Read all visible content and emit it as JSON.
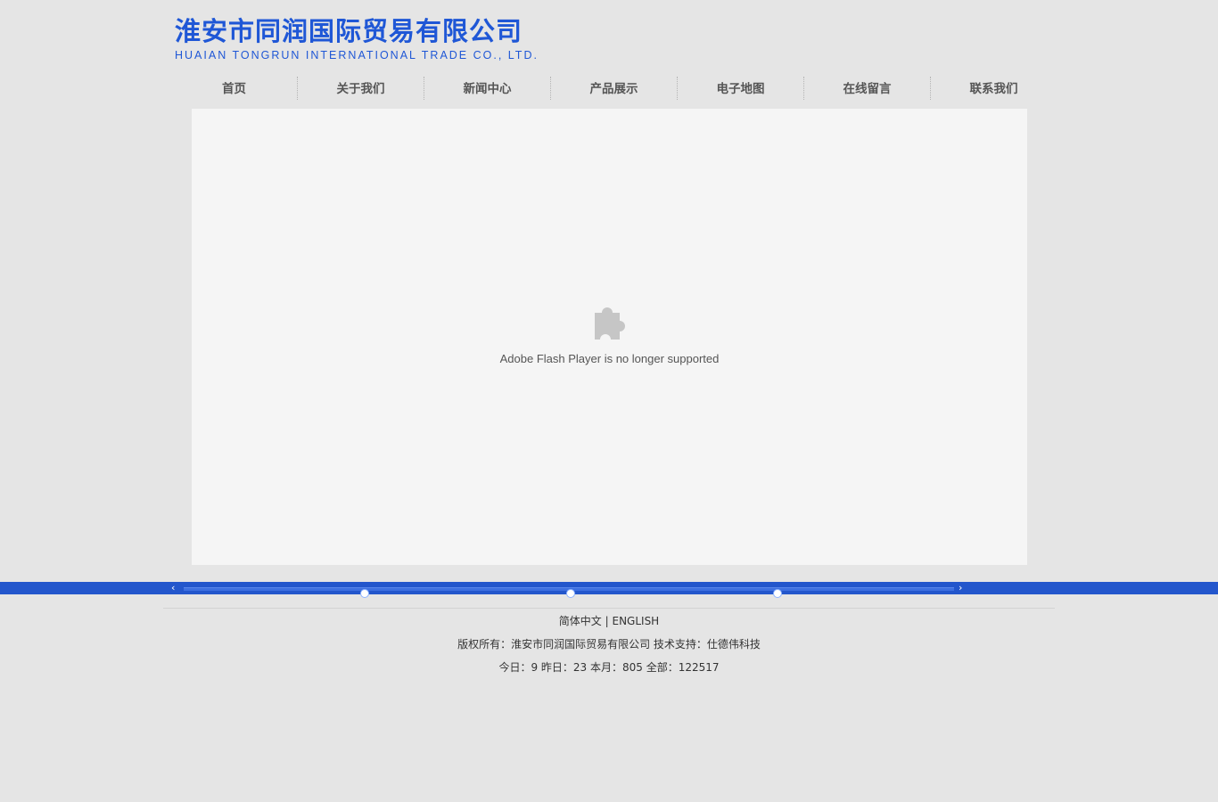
{
  "header": {
    "company_cn": "淮安市同润国际贸易有限公司",
    "company_en": "HUAIAN TONGRUN INTERNATIONAL TRADE CO., LTD."
  },
  "nav": {
    "items": [
      "首页",
      "关于我们",
      "新闻中心",
      "产品展示",
      "电子地图",
      "在线留言",
      "联系我们"
    ]
  },
  "flash": {
    "icon": "puzzle-piece-icon",
    "message": "Adobe Flash Player is no longer supported"
  },
  "slider": {
    "left_arrow": "‹",
    "right_arrow": "›",
    "dot_count": 3
  },
  "footer": {
    "lang_cn": "简体中文",
    "lang_sep": "|",
    "lang_en": "ENGLISH",
    "copyright": "版权所有：淮安市同润国际贸易有限公司 技术支持：仕德伟科技",
    "stats": "今日：9 昨日：23 本月：805 全部：122517"
  },
  "colors": {
    "brand_blue": "#1f57d6",
    "bar_blue": "#2356cc",
    "page_bg": "#e5e5e5"
  }
}
